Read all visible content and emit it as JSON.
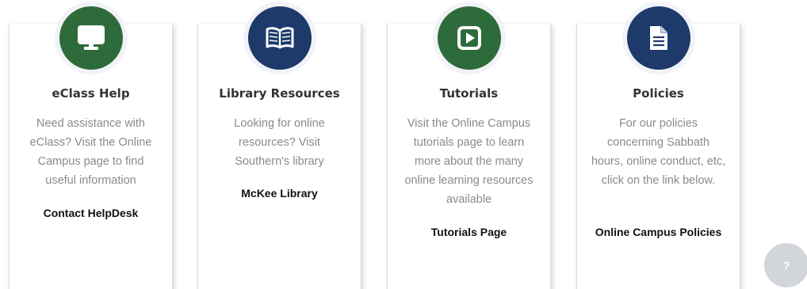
{
  "colors": {
    "green": "#2e6b3b",
    "navy": "#1d3a6b",
    "title": "#333333",
    "description": "#8a8a8a",
    "link": "#111111",
    "help_button_bg": "#d2d5da"
  },
  "cards": [
    {
      "icon": "monitor-icon",
      "icon_color": "#2e6b3b",
      "title": "eClass Help",
      "description": "Need assistance with eClass? Visit the Online Campus page to find useful information",
      "link": "Contact HelpDesk"
    },
    {
      "icon": "book-icon",
      "icon_color": "#1d3a6b",
      "title": "Library Resources",
      "description": "Looking for online resources? Visit Southern's library",
      "link": "McKee Library"
    },
    {
      "icon": "play-icon",
      "icon_color": "#2e6b3b",
      "title": "Tutorials",
      "description": "Visit the Online Campus tutorials page to learn more about the many online learning resources available",
      "link": "Tutorials Page"
    },
    {
      "icon": "document-icon",
      "icon_color": "#1d3a6b",
      "title": "Policies",
      "description": "For our policies concerning Sabbath hours, online conduct, etc, click on the link below.",
      "link": "Online Campus Policies"
    }
  ],
  "help_button": {
    "label": "?",
    "icon": "question-icon"
  }
}
